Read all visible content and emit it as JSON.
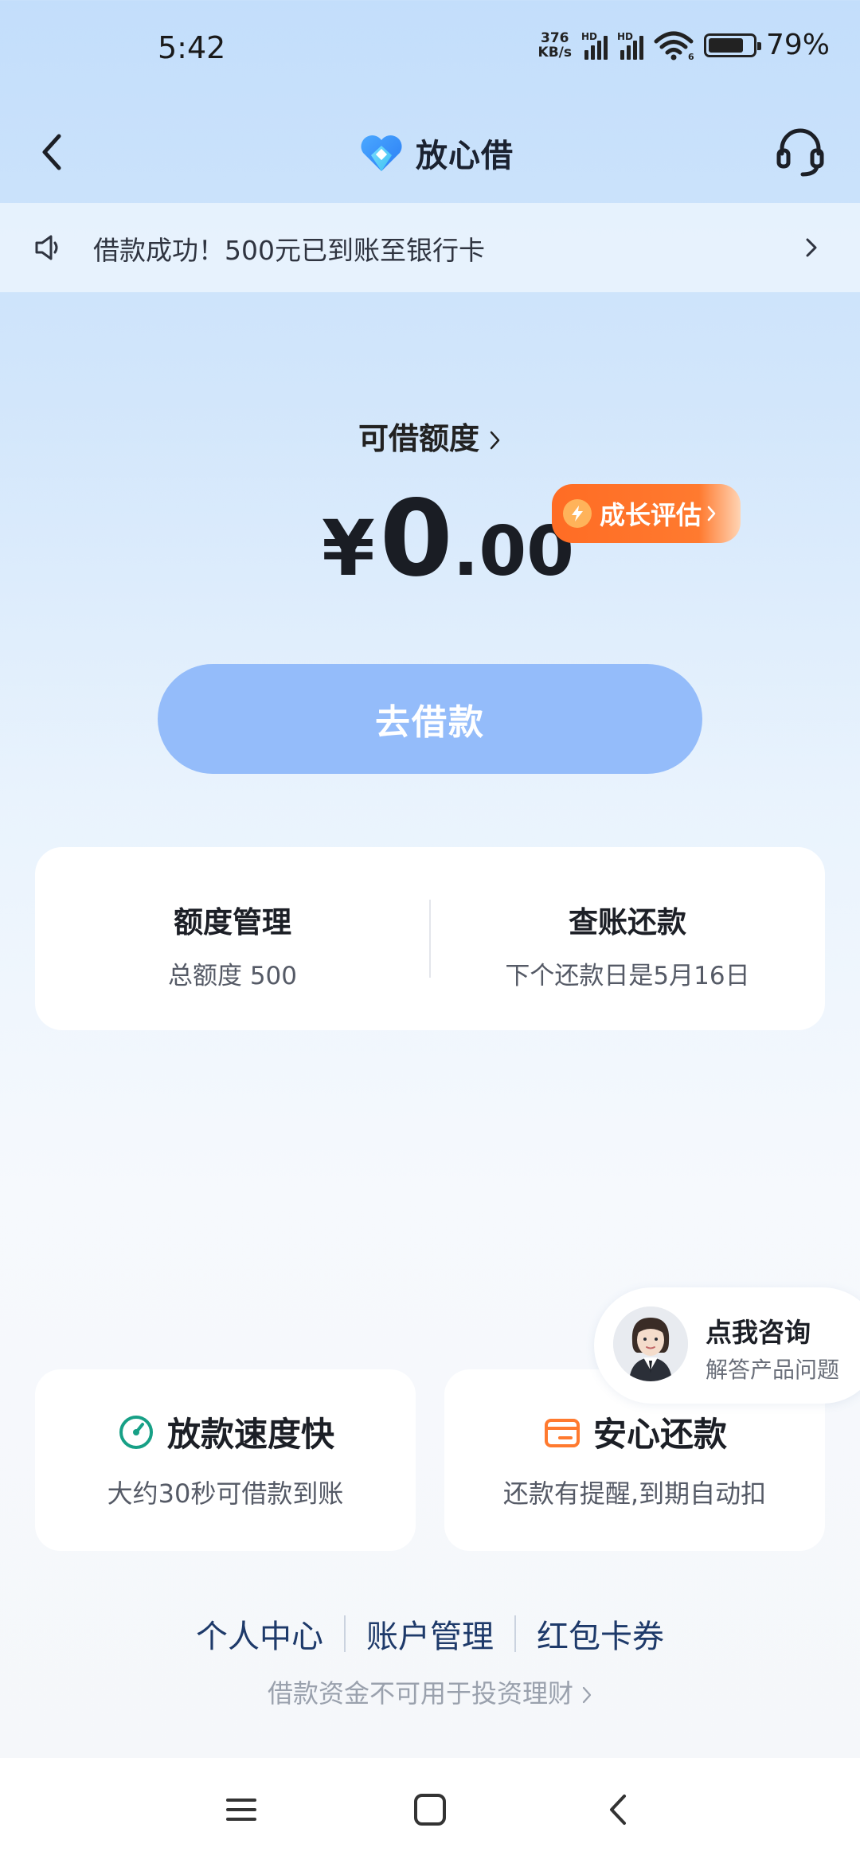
{
  "status_bar": {
    "time": "5:42",
    "net_speed_value": "376",
    "net_speed_unit": "KB/s",
    "sim1_label": "HD",
    "sim2_label": "HD",
    "wifi_label": "6",
    "battery_level": 0.79,
    "battery_pct": "79%"
  },
  "nav": {
    "title": "放心借",
    "back_icon": "chevron-left-icon",
    "service_icon": "headset-icon"
  },
  "notice": {
    "text": "借款成功！500元已到账至银行卡",
    "icon": "speaker-icon"
  },
  "credit": {
    "label": "可借额度",
    "currency": "¥",
    "amount_int": "0",
    "amount_dec": ".00",
    "growth_label": "成长评估"
  },
  "borrow_button": "去借款",
  "card": {
    "left_title": "额度管理",
    "left_sub": "总额度 500",
    "right_title": "查账还款",
    "right_sub": "下个还款日是5月16日"
  },
  "consult": {
    "title": "点我咨询",
    "sub": "解答产品问题"
  },
  "features": [
    {
      "title": "放款速度快",
      "sub": "大约30秒可借款到账",
      "icon": "speedometer-icon",
      "color": "#17a086"
    },
    {
      "title": "安心还款",
      "sub": "还款有提醒,到期自动扣",
      "icon": "wallet-icon",
      "color": "#ff7a2f"
    }
  ],
  "links": [
    "个人中心",
    "账户管理",
    "红包卡券"
  ],
  "disclaimer": "借款资金不可用于投资理财",
  "colors": {
    "accent_blue": "#94bcfa",
    "orange": "#ff6c24",
    "link": "#1e3a6a"
  }
}
